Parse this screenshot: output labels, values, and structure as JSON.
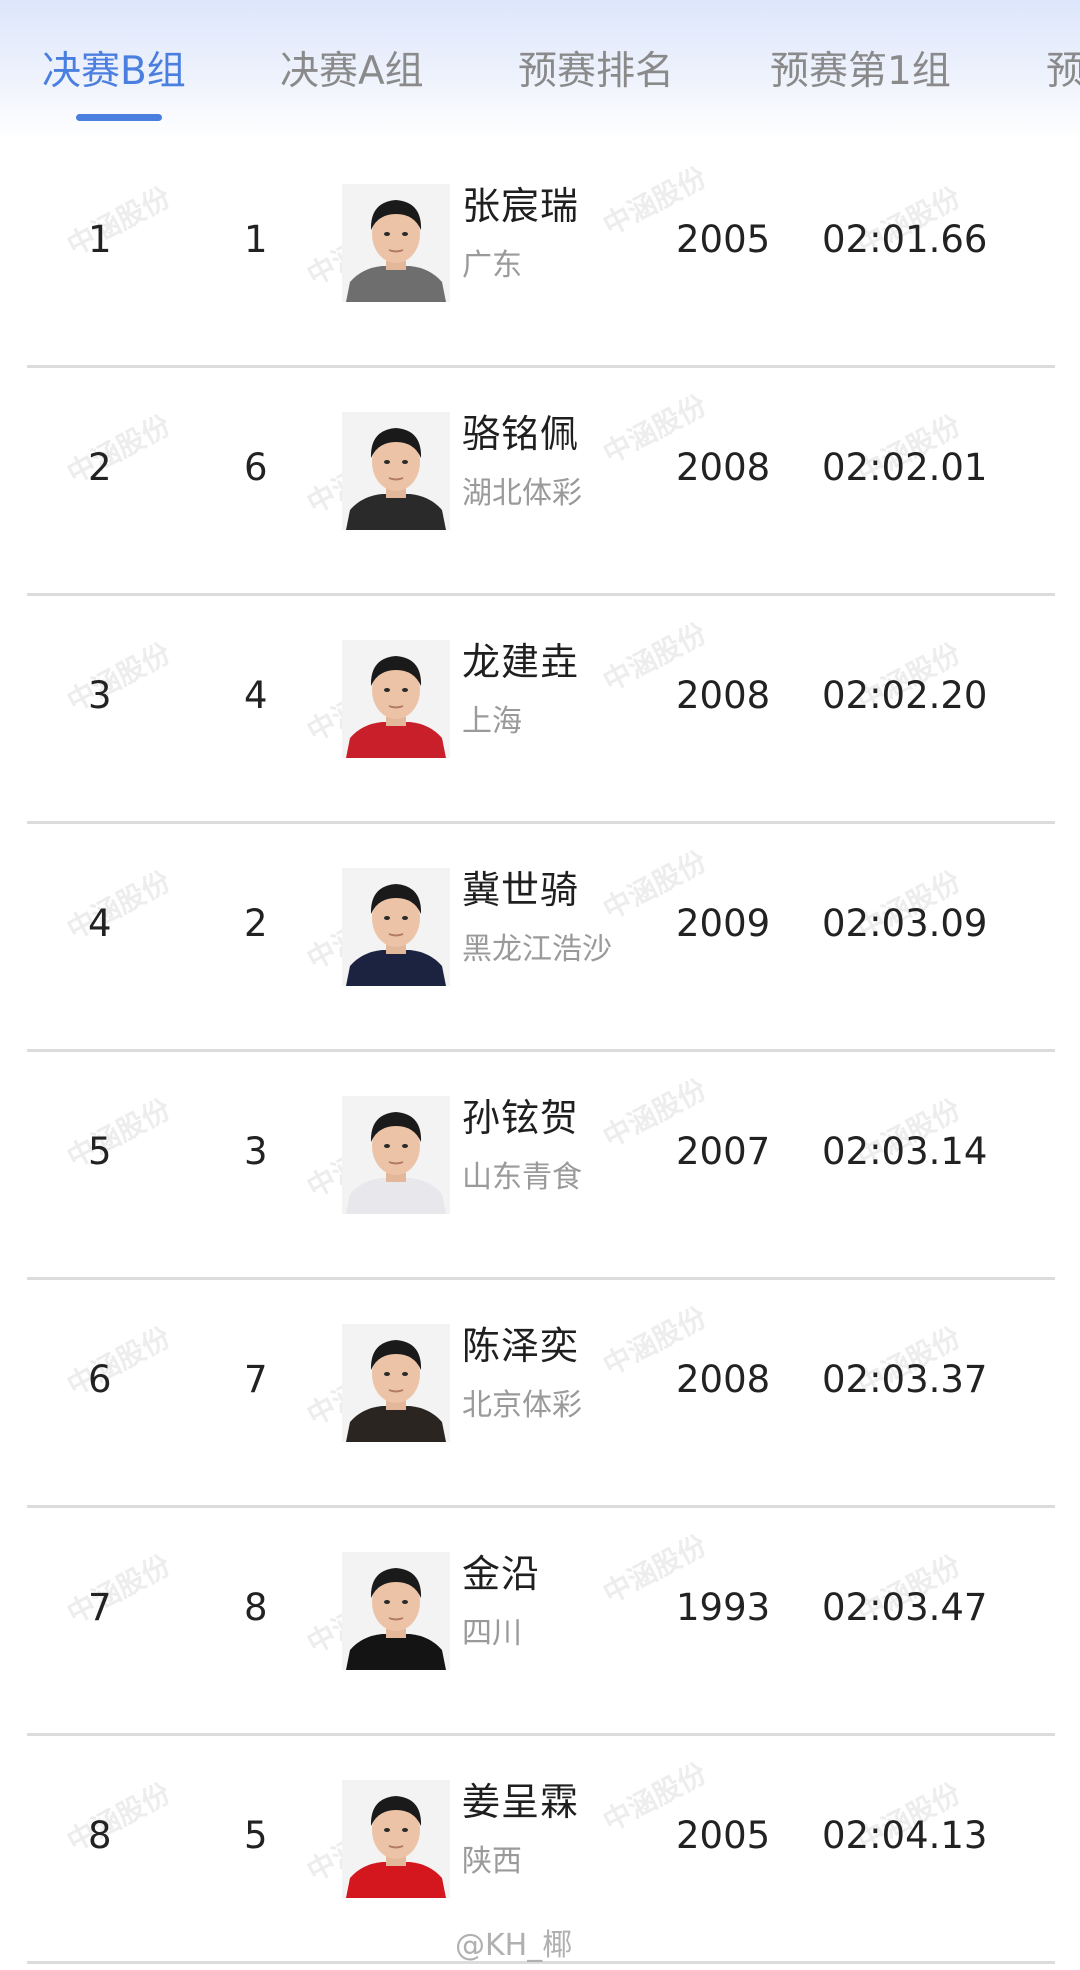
{
  "tabs": [
    {
      "label": "决赛B组",
      "active": true
    },
    {
      "label": "决赛A组",
      "active": false
    },
    {
      "label": "预赛排名",
      "active": false
    },
    {
      "label": "预赛第1组",
      "active": false
    },
    {
      "label": "预",
      "active": false
    }
  ],
  "results": [
    {
      "rank": "1",
      "lane": "1",
      "name": "张宸瑞",
      "team": "广东",
      "year": "2005",
      "time": "02:01.66",
      "shirt": "#6e6e6e"
    },
    {
      "rank": "2",
      "lane": "6",
      "name": "骆铭佩",
      "team": "湖北体彩",
      "year": "2008",
      "time": "02:02.01",
      "shirt": "#2a2a2a"
    },
    {
      "rank": "3",
      "lane": "4",
      "name": "龙建垚",
      "team": "上海",
      "year": "2008",
      "time": "02:02.20",
      "shirt": "#c81f2a"
    },
    {
      "rank": "4",
      "lane": "2",
      "name": "冀世骑",
      "team": "黑龙江浩沙",
      "year": "2009",
      "time": "02:03.09",
      "shirt": "#1b2340"
    },
    {
      "rank": "5",
      "lane": "3",
      "name": "孙铉贺",
      "team": "山东青食",
      "year": "2007",
      "time": "02:03.14",
      "shirt": "#e8e8ec"
    },
    {
      "rank": "6",
      "lane": "7",
      "name": "陈泽奕",
      "team": "北京体彩",
      "year": "2008",
      "time": "02:03.37",
      "shirt": "#2b2522"
    },
    {
      "rank": "7",
      "lane": "8",
      "name": "金沿",
      "team": "四川",
      "year": "1993",
      "time": "02:03.47",
      "shirt": "#141414"
    },
    {
      "rank": "8",
      "lane": "5",
      "name": "姜呈霖",
      "team": "陕西",
      "year": "2005",
      "time": "02:04.13",
      "shirt": "#d4161e"
    }
  ],
  "watermark": {
    "text": "中涵股份"
  },
  "footer": {
    "credit": "@KH_椰"
  }
}
